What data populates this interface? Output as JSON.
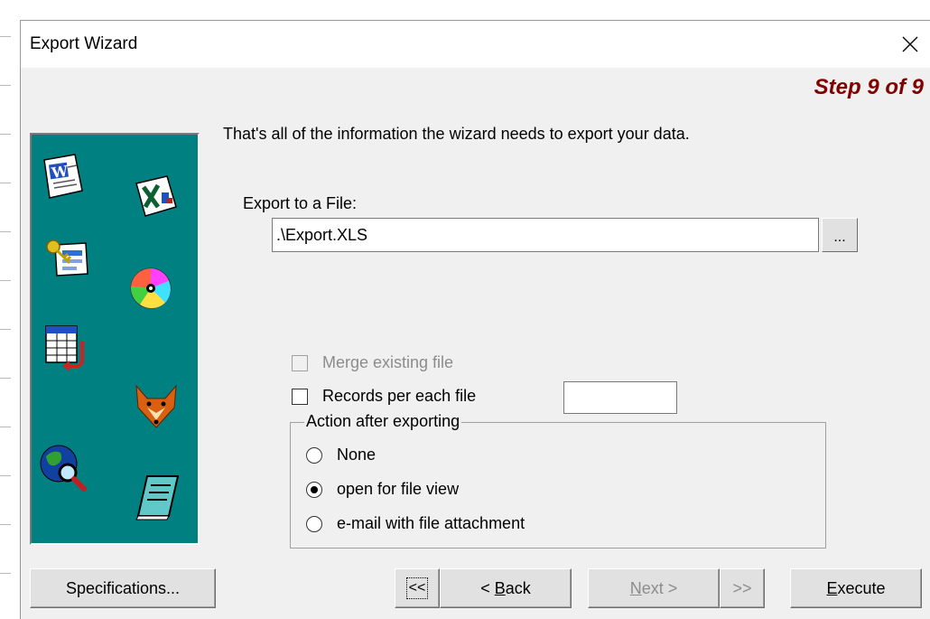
{
  "window": {
    "title": "Export Wizard",
    "step": "Step 9 of 9"
  },
  "main": {
    "info_text": "That's all of the information the wizard needs to export your data.",
    "export_label": "Export to a File:",
    "export_value": ".\\Export.XLS",
    "browse_label": "...",
    "merge_label": "Merge existing file",
    "merge_checked": false,
    "merge_enabled": false,
    "records_label": "Records per each file",
    "records_checked": false,
    "records_value": ""
  },
  "action_group": {
    "legend": "Action after exporting",
    "options": [
      {
        "label": "None",
        "selected": false
      },
      {
        "label": "open for file view",
        "selected": true
      },
      {
        "label": "e-mail with file attachment",
        "selected": false
      }
    ]
  },
  "buttons": {
    "specifications": "Specifications...",
    "first": "<<",
    "back_prefix": "< ",
    "back_accel": "B",
    "back_rest": "ack",
    "next_accel": "N",
    "next_rest": "ext >",
    "last": ">>",
    "execute_accel": "E",
    "execute_rest": "xecute"
  },
  "banner_icons": [
    "word-icon",
    "excel-icon",
    "key-icon",
    "disc-icon",
    "table-export-icon",
    "fox-icon",
    "globe-search-icon",
    "notepad-icon"
  ],
  "colors": {
    "step": "#800000",
    "banner": "#008080",
    "window_bg": "#f0f0f0"
  }
}
